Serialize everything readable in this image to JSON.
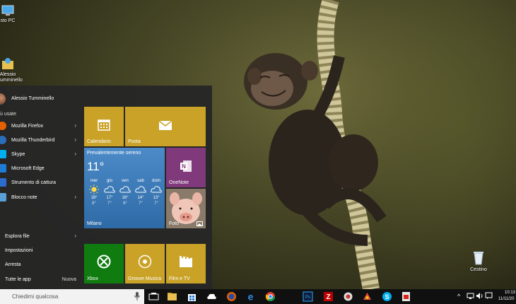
{
  "desktop": {
    "icons": [
      {
        "label": "sto PC",
        "icon": "computer-icon"
      },
      {
        "label": "Alessio\nTumminello",
        "icon": "user-folder-icon"
      },
      {
        "label": "Cestino",
        "icon": "recycle-bin-icon"
      }
    ]
  },
  "start_menu": {
    "user_name": "Alessio Tumminello",
    "most_used_label": "ù usate",
    "apps": [
      {
        "label": "Mozilla Firefox",
        "icon": "firefox-icon",
        "color": "#e66000",
        "has_arrow": true
      },
      {
        "label": "Mozilla Thunderbird",
        "icon": "thunderbird-icon",
        "color": "#2a6ebb",
        "has_arrow": true
      },
      {
        "label": "Skype",
        "icon": "skype-icon",
        "color": "#00aff0",
        "has_arrow": true
      },
      {
        "label": "Microsoft Edge",
        "icon": "edge-icon",
        "color": "#1e7bd6",
        "has_arrow": false
      },
      {
        "label": "Strumento di cattura",
        "icon": "snipping-tool-icon",
        "color": "#2b6ccc",
        "has_arrow": false
      },
      {
        "label": "Blocco note",
        "icon": "notepad-icon",
        "color": "#5aa0d8",
        "has_arrow": true
      }
    ],
    "system": [
      {
        "label": "Esplora file",
        "has_arrow": true
      },
      {
        "label": "Impostazioni",
        "has_arrow": false
      },
      {
        "label": "Arresta",
        "has_arrow": false
      },
      {
        "label": "Tutte le app",
        "badge": "Nuova"
      }
    ],
    "tiles": {
      "calendar": {
        "label": "Calendario",
        "color": "#c9a227"
      },
      "mail": {
        "label": "Posta",
        "color": "#c9a227"
      },
      "weather": {
        "title": "Prevalentemente sereno",
        "temp": "11°",
        "city": "Milano",
        "color": "#3a79b8",
        "days": [
          {
            "day": "mer",
            "hi": "18°",
            "lo": "8°",
            "icon": "sun-icon"
          },
          {
            "day": "gio",
            "hi": "17°",
            "lo": "7°",
            "icon": "cloud-icon"
          },
          {
            "day": "ven",
            "hi": "16°",
            "lo": "8°",
            "icon": "cloud-icon"
          },
          {
            "day": "sab",
            "hi": "14°",
            "lo": "7°",
            "icon": "cloud-icon"
          },
          {
            "day": "dom",
            "hi": "13°",
            "lo": "7°",
            "icon": "cloud-icon"
          }
        ]
      },
      "onenote": {
        "label": "OneNote",
        "color": "#80397b"
      },
      "photos": {
        "label": "Foto"
      },
      "xbox": {
        "label": "Xbox",
        "color": "#107c10"
      },
      "groove": {
        "label": "Groove Musica",
        "color": "#c9a227"
      },
      "movies": {
        "label": "Film e TV",
        "color": "#c9a227"
      }
    }
  },
  "taskbar": {
    "search_placeholder": "Chiedimi qualcosa",
    "pinned": [
      "task-view-icon",
      "file-explorer-icon",
      "store-icon",
      "onedrive-icon",
      "firefox-icon",
      "edge-icon",
      "chrome-icon",
      "photoshop-icon",
      "filezilla-icon",
      "app-icon",
      "game-icon",
      "skype-icon",
      "pdf-icon"
    ],
    "time": "10:13",
    "date": "11/11/20"
  }
}
